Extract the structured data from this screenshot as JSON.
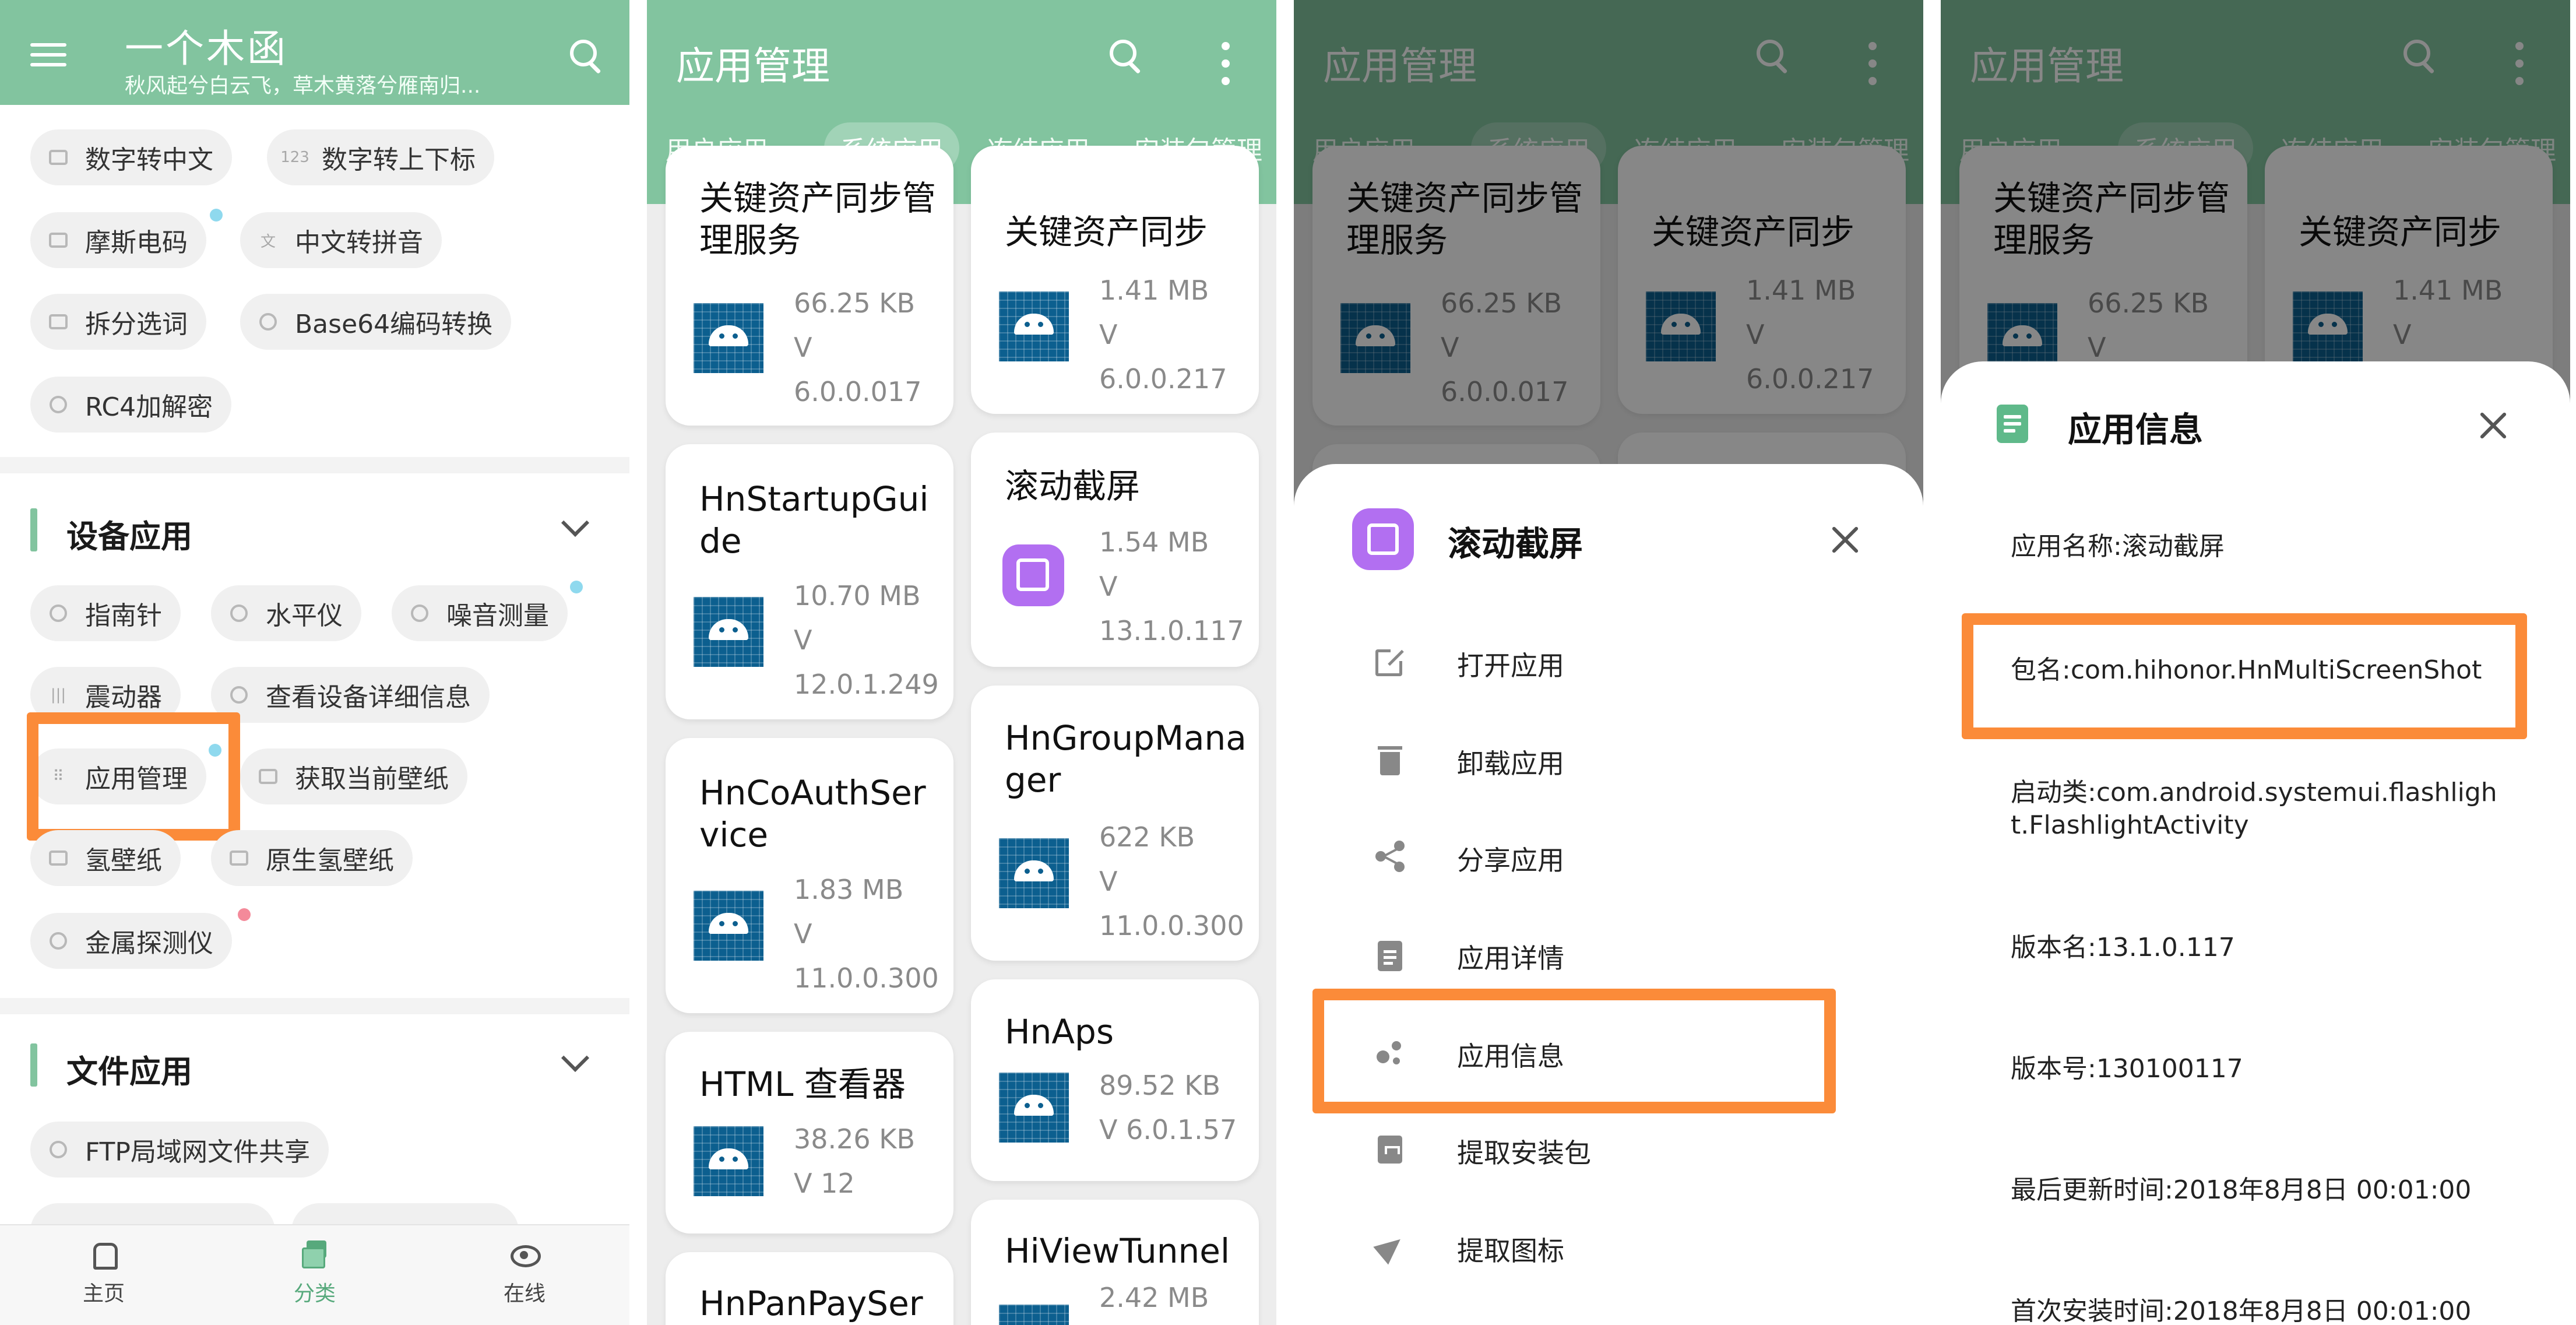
{
  "colors": {
    "accent": "#82c49f",
    "highlight": "#fb8b39",
    "badge_blue": "#8fd9ee",
    "badge_pink": "#f48a9a",
    "app_icon_purple": "#b26ff1",
    "android_icon_blue": "#0c5f8f"
  },
  "panel1": {
    "title": "一个木函",
    "subtitle": "秋风起兮白云飞，草木黄落兮雁南归...",
    "top_chips": [
      {
        "label": "数字转中文",
        "icon": "number-icon"
      },
      {
        "label": "数字转上下标",
        "icon": "123-icon"
      },
      {
        "label": "摩斯电码",
        "icon": "morse-icon"
      },
      {
        "label": "中文转拼音",
        "icon": "pinyin-icon"
      },
      {
        "label": "拆分选词",
        "icon": "split-icon"
      },
      {
        "label": "Base64编码转换",
        "icon": "lock-icon"
      },
      {
        "label": "RC4加解密",
        "icon": "lock-icon"
      }
    ],
    "section_device": "设备应用",
    "device_chips": [
      {
        "label": "指南针",
        "icon": "compass-icon"
      },
      {
        "label": "水平仪",
        "icon": "level-icon"
      },
      {
        "label": "噪音测量",
        "icon": "noise-icon"
      },
      {
        "label": "震动器",
        "icon": "vibrate-icon"
      },
      {
        "label": "查看设备详细信息",
        "icon": "device-info-icon"
      },
      {
        "label": "应用管理",
        "icon": "grid-icon"
      },
      {
        "label": "获取当前壁纸",
        "icon": "wallpaper-icon"
      },
      {
        "label": "氢壁纸",
        "icon": "wallpaper-icon"
      },
      {
        "label": "原生氢壁纸",
        "icon": "wallpaper-icon"
      },
      {
        "label": "金属探测仪",
        "icon": "metal-detector-icon"
      }
    ],
    "section_file": "文件应用",
    "file_chips": [
      {
        "label": "FTP局域网文件共享",
        "icon": "wifi-icon"
      }
    ],
    "bottom_nav": [
      {
        "label": "主页",
        "icon": "home-icon"
      },
      {
        "label": "分类",
        "icon": "category-icon"
      },
      {
        "label": "在线",
        "icon": "eye-icon"
      }
    ]
  },
  "app_manager": {
    "title": "应用管理",
    "tabs": [
      "用户应用",
      "系统应用",
      "冻结应用",
      "安装包管理"
    ],
    "selected_tab": "系统应用",
    "left_cards": [
      {
        "name": "关键资产同步管理服务",
        "size": "66.25 KB",
        "version_prefix": "V",
        "version": "6.0.0.017",
        "icon": "android-icon"
      },
      {
        "name": "HnStartupGuide",
        "size": "10.70 MB",
        "version_prefix": "V",
        "version": "12.0.1.249",
        "icon": "android-icon"
      },
      {
        "name": "HnCoAuthService",
        "size": "1.83 MB",
        "version_prefix": "V",
        "version": "11.0.0.300",
        "icon": "android-icon"
      },
      {
        "name": "HTML 查看器",
        "size": "38.26 KB",
        "version_prefix": "V 12",
        "version": "",
        "icon": "android-icon"
      },
      {
        "name": "HnPanPaySer",
        "size": "",
        "version_prefix": "",
        "version": "",
        "icon": "android-icon"
      }
    ],
    "right_cards": [
      {
        "name": "关键资产同步",
        "size": "1.41 MB",
        "version_prefix": "V",
        "version": "6.0.0.217",
        "icon": "android-icon"
      },
      {
        "name": "滚动截屏",
        "size": "1.54 MB",
        "version_prefix": "V",
        "version": "13.1.0.117",
        "icon": "screenshot-icon"
      },
      {
        "name": "HnGroupManager",
        "size": "622 KB",
        "version_prefix": "V",
        "version": "11.0.0.300",
        "icon": "android-icon"
      },
      {
        "name": "HnAps",
        "size": "89.52 KB",
        "version_prefix": "V 6.0.1.57",
        "version": "",
        "icon": "android-icon"
      },
      {
        "name": "HiViewTunnel",
        "size": "2.42 MB",
        "version_prefix": "",
        "version": "",
        "icon": "android-icon"
      }
    ]
  },
  "sheet": {
    "app_name": "滚动截屏",
    "items": [
      {
        "label": "打开应用",
        "icon": "open-external-icon"
      },
      {
        "label": "卸载应用",
        "icon": "trash-icon"
      },
      {
        "label": "分享应用",
        "icon": "share-icon"
      },
      {
        "label": "应用详情",
        "icon": "clipboard-icon"
      },
      {
        "label": "应用信息",
        "icon": "info-dots-icon"
      },
      {
        "label": "提取安装包",
        "icon": "archive-icon"
      },
      {
        "label": "提取图标",
        "icon": "send-icon"
      }
    ]
  },
  "dialog": {
    "title": "应用信息",
    "rows": [
      "应用名称:滚动截屏",
      "包名:com.hihonor.HnMultiScreenShot",
      "启动类:com.android.systemui.flashlight.FlashlightActivity",
      "版本名:13.1.0.117",
      "版本号:130100117",
      "最后更新时间:2018年8月8日 00:01:00",
      "首次安装时间:2018年8月8日 00:01:00"
    ]
  }
}
